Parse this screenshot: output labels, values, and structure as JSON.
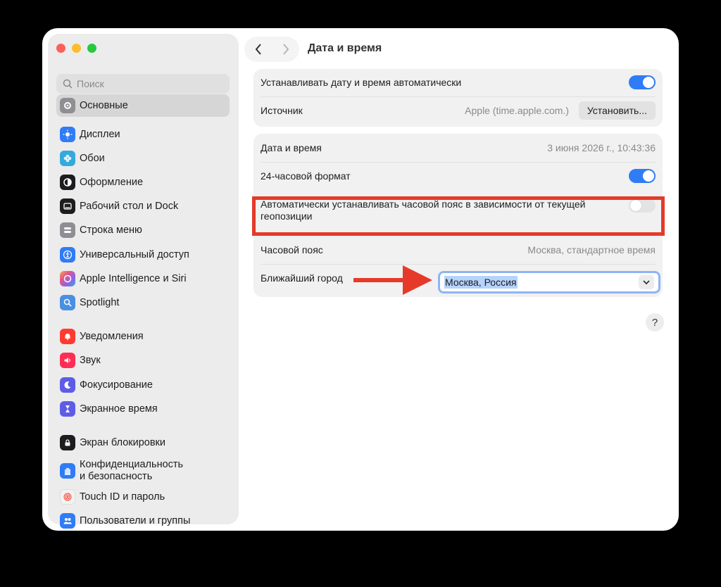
{
  "window": {
    "title": "Дата и время"
  },
  "sidebar": {
    "search_placeholder": "Поиск",
    "items": [
      {
        "label": "Основные",
        "icon": "gear-icon",
        "color": "#8e8e93"
      },
      {
        "label": "Дисплеи",
        "icon": "sun-icon",
        "color": "#2f7cf6"
      },
      {
        "label": "Обои",
        "icon": "flower-icon",
        "color": "#35aadc"
      },
      {
        "label": "Оформление",
        "icon": "appearance-icon",
        "color": "#1d1d1f"
      },
      {
        "label": "Рабочий стол и Dock",
        "icon": "dock-icon",
        "color": "#1d1d1f"
      },
      {
        "label": "Строка меню",
        "icon": "menubar-icon",
        "color": "#8e8e93"
      },
      {
        "label": "Универсальный доступ",
        "icon": "accessibility-icon",
        "color": "#2f7cf6"
      },
      {
        "label": "Apple Intelligence и Siri",
        "icon": "siri-icon",
        "color": "#e0578a"
      },
      {
        "label": "Spotlight",
        "icon": "spotlight-icon",
        "color": "#4a90e2"
      },
      {
        "label": "Уведомления",
        "icon": "bell-icon",
        "color": "#ff3b30"
      },
      {
        "label": "Звук",
        "icon": "speaker-icon",
        "color": "#ff2d55"
      },
      {
        "label": "Фокусирование",
        "icon": "moon-icon",
        "color": "#5e5ce6"
      },
      {
        "label": "Экранное время",
        "icon": "hourglass-icon",
        "color": "#5e5ce6"
      },
      {
        "label": "Экран блокировки",
        "icon": "lock-icon",
        "color": "#1d1d1f"
      },
      {
        "label": "Конфиденциальность",
        "label2": "и безопасность",
        "icon": "hand-icon",
        "color": "#2f7cf6"
      },
      {
        "label": "Touch ID и пароль",
        "icon": "fingerprint-icon",
        "color": "#f2f2f2"
      },
      {
        "label": "Пользователи и группы",
        "icon": "users-icon",
        "color": "#2f7cf6"
      }
    ]
  },
  "main": {
    "auto_datetime": {
      "label": "Устанавливать дату и время автоматически",
      "enabled": true
    },
    "source": {
      "label": "Источник",
      "value": "Apple (time.apple.com.)",
      "button": "Установить..."
    },
    "datetime": {
      "label": "Дата и время",
      "value": "3 июня 2026 г., 10:43:36"
    },
    "format24": {
      "label": "24-часовой формат",
      "enabled": true
    },
    "auto_timezone": {
      "line1": "Автоматически устанавливать часовой пояс в зависимости от текущей",
      "line2": "геопозиции",
      "enabled": false
    },
    "timezone": {
      "label": "Часовой пояс",
      "value": "Москва, стандартное время"
    },
    "closest_city": {
      "label": "Ближайший город",
      "value": "Москва, Россия"
    },
    "help": "?"
  },
  "colors": {
    "accent": "#2f7cf6",
    "annotation": "#e53a29"
  }
}
